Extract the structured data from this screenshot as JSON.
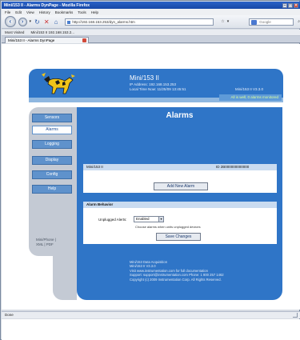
{
  "browser": {
    "window_title": "Mini/153 II - Alarms DynPage - Mozilla Firefox",
    "menu": [
      "File",
      "Edit",
      "View",
      "History",
      "Bookmarks",
      "Tools",
      "Help"
    ],
    "url": "http://192.168.153.253/dyn_alarms.htm",
    "search_placeholder": "Google",
    "bookmarks": [
      "Most Visited",
      "Mini/153 II 192.168.153.2..."
    ],
    "tab_title": "Mini/153 II - Alarms DynPage",
    "status_text": "Done"
  },
  "header": {
    "device_title": "Mini/153 II",
    "ip_line": "IP Address: 192.168.153.253",
    "time_line": "Local Time Now: 11/25/09 13:45:51",
    "version": "Mini/153 II V3.3.0",
    "status_banner": "All is well, 0 alarms monitored"
  },
  "nav": {
    "items": [
      "Sensors",
      "Alarms",
      "Logging",
      "Display",
      "Config",
      "Help"
    ],
    "active": "Alarms",
    "extra_line1": "Mini/Phone  |",
    "extra_line2": "XML  |  PDF"
  },
  "main": {
    "title": "Alarms",
    "alarm_device": "Mini/153 II",
    "alarm_id": "ID 2B000000000000",
    "add_alarm_label": "Add New Alarm",
    "behavior_title": "Alarm Behavior",
    "unplugged_label": "Unplugged Alerts:",
    "unplugged_value": "Enabled",
    "unplugged_help": "Choose alarms when units unplugged devices",
    "save_label": "Save Changes"
  },
  "footer": {
    "lines": [
      "Mini/153 Data Acquisition",
      "Mini/153 II V3.3.0",
      "Visit www.instrumentation.com for full documentation",
      "Support: support@instrumentation.com  Phone: 1 800 257 1462",
      "Copyright (c) 2009 Instrumentation Corp. All Rights Reserved."
    ]
  },
  "colors": {
    "primary_blue": "#2f75c7",
    "nav_button": "#5f92cc",
    "status_green": "#dcff9a"
  }
}
